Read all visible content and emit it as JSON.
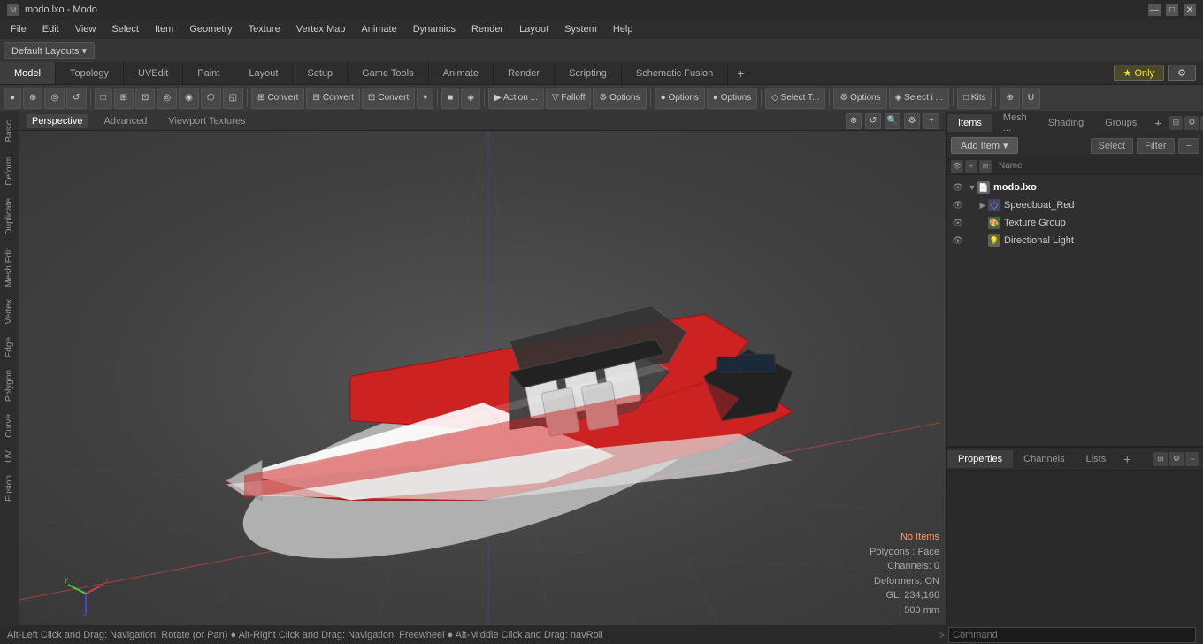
{
  "titlebar": {
    "title": "modo.lxo - Modo",
    "icon": "M",
    "min_label": "—",
    "max_label": "□",
    "close_label": "✕"
  },
  "menubar": {
    "items": [
      "File",
      "Edit",
      "View",
      "Select",
      "Item",
      "Geometry",
      "Texture",
      "Vertex Map",
      "Animate",
      "Dynamics",
      "Render",
      "Layout",
      "System",
      "Help"
    ]
  },
  "layoutbar": {
    "layout_dropdown": "Default Layouts ▾"
  },
  "modebar": {
    "tabs": [
      "Model",
      "Topology",
      "UVEdit",
      "Paint",
      "Layout",
      "Setup",
      "Game Tools",
      "Animate",
      "Render",
      "Scripting",
      "Schematic Fusion"
    ],
    "active": "Model",
    "plus_label": "+",
    "only_label": "Only",
    "gear_label": "⚙"
  },
  "toolbar": {
    "groups": [
      {
        "buttons": [
          "●",
          "⊕",
          "▽",
          "⟳"
        ]
      },
      {
        "buttons": [
          "□",
          "⊞",
          "⊡",
          "◎",
          "◉",
          "⬡",
          "◱"
        ]
      },
      {
        "label_btn": "Convert",
        "icon": "⊞"
      },
      {
        "label_btn": "Convert",
        "icon": "⊟"
      },
      {
        "label_btn": "Convert",
        "icon": "⊡"
      },
      {
        "dropdown_btn": "▾"
      },
      {
        "buttons": [
          "■",
          "◈"
        ]
      },
      {
        "label_btn": "Action ...",
        "icon": "▶"
      },
      {
        "label_btn": "Falloff",
        "icon": "▽"
      },
      {
        "label_btn": "Options",
        "icon": "⚙"
      },
      {
        "sep": true
      },
      {
        "label_btn": "Options",
        "icon": "●"
      },
      {
        "label_btn": "Options",
        "icon": "●"
      },
      {
        "sep": true
      },
      {
        "label_btn": "Select T...",
        "icon": "◇"
      },
      {
        "sep": true
      },
      {
        "label_btn": "Options",
        "icon": "⚙"
      },
      {
        "label_btn": "Select i ...",
        "icon": "◈"
      },
      {
        "sep": true
      },
      {
        "label_btn": "Kits",
        "icon": "□"
      },
      {
        "sep": true
      },
      {
        "buttons": [
          "⊕",
          "U"
        ]
      }
    ]
  },
  "viewport": {
    "tabs": [
      "Perspective",
      "Advanced",
      "Viewport Textures"
    ],
    "active": "Perspective",
    "controls": [
      "⊕",
      "↺",
      "🔍",
      "⚙",
      "+"
    ]
  },
  "scene": {
    "status": {
      "no_items": "No Items",
      "polygons": "Polygons : Face",
      "channels": "Channels: 0",
      "deformers": "Deformers: ON",
      "gl": "GL: 234,166",
      "size": "500 mm"
    },
    "axis_hint": "XYZ"
  },
  "left_sidebar": {
    "tabs": [
      "Basic",
      "Deform.",
      "Duplicate",
      "Mesh Edit",
      "Vertex",
      "Edge",
      "Polygon",
      "Curve",
      "UV",
      "Fusion"
    ]
  },
  "right_panel": {
    "panel_tabs": [
      "Items",
      "Mesh ...",
      "Shading",
      "Groups"
    ],
    "active_tab": "Items",
    "items_toolbar": {
      "add_item": "Add Item",
      "dropdown": "▾",
      "select_btn": "Select",
      "filter_btn": "Filter",
      "minus_btn": "−"
    },
    "items_header": {
      "eye_icon": "👁",
      "plus_icon": "+",
      "link_icon": "⊞",
      "name_col": "Name"
    },
    "tree": [
      {
        "id": "root",
        "label": "modo.lxo",
        "icon": "📄",
        "indent": 0,
        "has_arrow": true,
        "expanded": true,
        "visible": true
      },
      {
        "id": "speedboat",
        "label": "Speedboat_Red",
        "icon": "⬡",
        "indent": 1,
        "has_arrow": true,
        "expanded": false,
        "visible": true
      },
      {
        "id": "texture_group",
        "label": "Texture Group",
        "icon": "🎨",
        "indent": 1,
        "has_arrow": false,
        "expanded": false,
        "visible": true
      },
      {
        "id": "dir_light",
        "label": "Directional Light",
        "icon": "💡",
        "indent": 1,
        "has_arrow": false,
        "expanded": false,
        "visible": true
      }
    ]
  },
  "properties_panel": {
    "tabs": [
      "Properties",
      "Channels",
      "Lists"
    ],
    "active_tab": "Properties",
    "plus_label": "+"
  },
  "statusbar": {
    "text": "Alt-Left Click and Drag: Navigation: Rotate (or Pan)  ● Alt-Right Click and Drag: Navigation: Freewheel  ● Alt-Middle Click and Drag: navRoll",
    "arrow": ">",
    "command_placeholder": "Command"
  }
}
